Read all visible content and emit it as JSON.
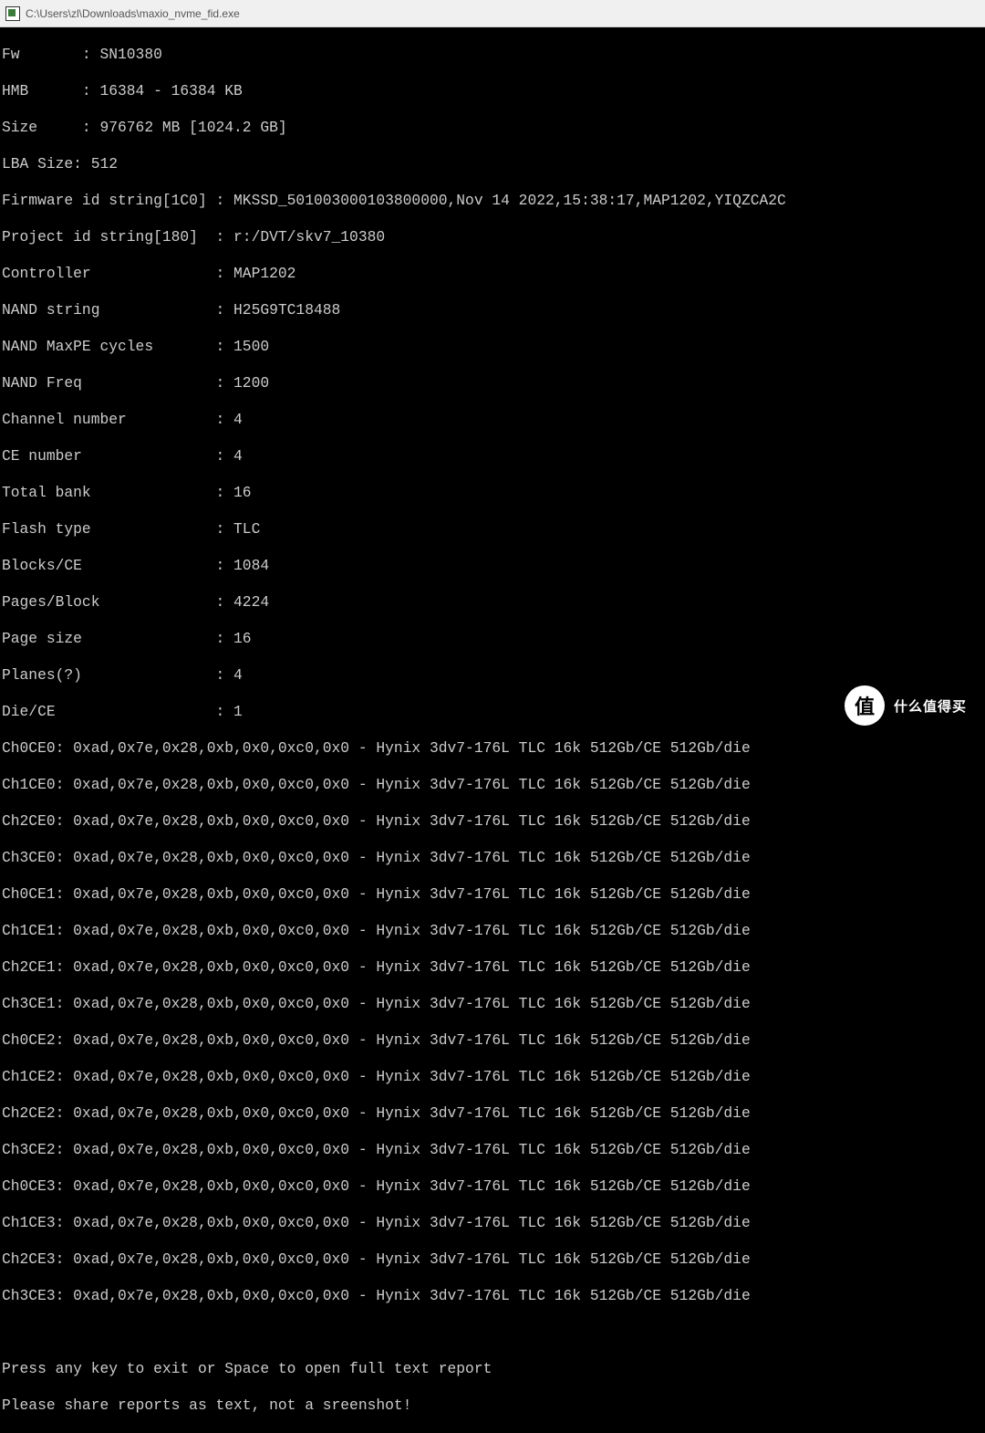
{
  "window": {
    "title": "C:\\Users\\zl\\Downloads\\maxio_nvme_fid.exe"
  },
  "fields": {
    "fw": {
      "label": "Fw",
      "value": "SN10380"
    },
    "hmb": {
      "label": "HMB",
      "value": "16384 - 16384 KB"
    },
    "size": {
      "label": "Size",
      "value": "976762 MB [1024.2 GB]"
    },
    "lba": {
      "label": "LBA Size",
      "value": "512"
    },
    "fwid": {
      "label": "Firmware id string[1C0]",
      "value": "MKSSD_501003000103800000,Nov 14 2022,15:38:17,MAP1202,YIQZCA2C"
    },
    "pjid": {
      "label": "Project id string[180]",
      "value": "r:/DVT/skv7_10380"
    },
    "ctrl": {
      "label": "Controller",
      "value": "MAP1202"
    },
    "nand": {
      "label": "NAND string",
      "value": "H25G9TC18488"
    },
    "maxpe": {
      "label": "NAND MaxPE cycles",
      "value": "1500"
    },
    "nfreq": {
      "label": "NAND Freq",
      "value": "1200"
    },
    "chnum": {
      "label": "Channel number",
      "value": "4"
    },
    "cenum": {
      "label": "CE number",
      "value": "4"
    },
    "tbank": {
      "label": "Total bank",
      "value": "16"
    },
    "ftype": {
      "label": "Flash type",
      "value": "TLC"
    },
    "bce": {
      "label": "Blocks/CE",
      "value": "1084"
    },
    "pblk": {
      "label": "Pages/Block",
      "value": "4224"
    },
    "psize": {
      "label": "Page size",
      "value": "16"
    },
    "planes": {
      "label": "Planes(?)",
      "value": "4"
    },
    "diece": {
      "label": "Die/CE",
      "value": "1"
    }
  },
  "formatted": {
    "l1": "Fw       : SN10380",
    "l2": "HMB      : 16384 - 16384 KB",
    "l3": "Size     : 976762 MB [1024.2 GB]",
    "l4": "LBA Size: 512",
    "l5": "Firmware id string[1C0] : MKSSD_501003000103800000,Nov 14 2022,15:38:17,MAP1202,YIQZCA2C",
    "l6": "Project id string[180]  : r:/DVT/skv7_10380",
    "l7": "Controller              : MAP1202",
    "l8": "NAND string             : H25G9TC18488",
    "l9": "NAND MaxPE cycles       : 1500",
    "l10": "NAND Freq               : 1200",
    "l11": "Channel number          : 4",
    "l12": "CE number               : 4",
    "l13": "Total bank              : 16",
    "l14": "Flash type              : TLC",
    "l15": "Blocks/CE               : 1084",
    "l16": "Pages/Block             : 4224",
    "l17": "Page size               : 16",
    "l18": "Planes(?)               : 4",
    "l19": "Die/CE                  : 1"
  },
  "chip_lines": {
    "c0": "Ch0CE0: 0xad,0x7e,0x28,0xb,0x0,0xc0,0x0 - Hynix 3dv7-176L TLC 16k 512Gb/CE 512Gb/die",
    "c1": "Ch1CE0: 0xad,0x7e,0x28,0xb,0x0,0xc0,0x0 - Hynix 3dv7-176L TLC 16k 512Gb/CE 512Gb/die",
    "c2": "Ch2CE0: 0xad,0x7e,0x28,0xb,0x0,0xc0,0x0 - Hynix 3dv7-176L TLC 16k 512Gb/CE 512Gb/die",
    "c3": "Ch3CE0: 0xad,0x7e,0x28,0xb,0x0,0xc0,0x0 - Hynix 3dv7-176L TLC 16k 512Gb/CE 512Gb/die",
    "c4": "Ch0CE1: 0xad,0x7e,0x28,0xb,0x0,0xc0,0x0 - Hynix 3dv7-176L TLC 16k 512Gb/CE 512Gb/die",
    "c5": "Ch1CE1: 0xad,0x7e,0x28,0xb,0x0,0xc0,0x0 - Hynix 3dv7-176L TLC 16k 512Gb/CE 512Gb/die",
    "c6": "Ch2CE1: 0xad,0x7e,0x28,0xb,0x0,0xc0,0x0 - Hynix 3dv7-176L TLC 16k 512Gb/CE 512Gb/die",
    "c7": "Ch3CE1: 0xad,0x7e,0x28,0xb,0x0,0xc0,0x0 - Hynix 3dv7-176L TLC 16k 512Gb/CE 512Gb/die",
    "c8": "Ch0CE2: 0xad,0x7e,0x28,0xb,0x0,0xc0,0x0 - Hynix 3dv7-176L TLC 16k 512Gb/CE 512Gb/die",
    "c9": "Ch1CE2: 0xad,0x7e,0x28,0xb,0x0,0xc0,0x0 - Hynix 3dv7-176L TLC 16k 512Gb/CE 512Gb/die",
    "c10": "Ch2CE2: 0xad,0x7e,0x28,0xb,0x0,0xc0,0x0 - Hynix 3dv7-176L TLC 16k 512Gb/CE 512Gb/die",
    "c11": "Ch3CE2: 0xad,0x7e,0x28,0xb,0x0,0xc0,0x0 - Hynix 3dv7-176L TLC 16k 512Gb/CE 512Gb/die",
    "c12": "Ch0CE3: 0xad,0x7e,0x28,0xb,0x0,0xc0,0x0 - Hynix 3dv7-176L TLC 16k 512Gb/CE 512Gb/die",
    "c13": "Ch1CE3: 0xad,0x7e,0x28,0xb,0x0,0xc0,0x0 - Hynix 3dv7-176L TLC 16k 512Gb/CE 512Gb/die",
    "c14": "Ch2CE3: 0xad,0x7e,0x28,0xb,0x0,0xc0,0x0 - Hynix 3dv7-176L TLC 16k 512Gb/CE 512Gb/die",
    "c15": "Ch3CE3: 0xad,0x7e,0x28,0xb,0x0,0xc0,0x0 - Hynix 3dv7-176L TLC 16k 512Gb/CE 512Gb/die"
  },
  "footer": {
    "blank": " ",
    "msg1": "Press any key to exit or Space to open full text report",
    "msg2": "Please share reports as text, not a sreenshot!"
  },
  "badge": {
    "char": "值",
    "text": "什么值得买"
  }
}
